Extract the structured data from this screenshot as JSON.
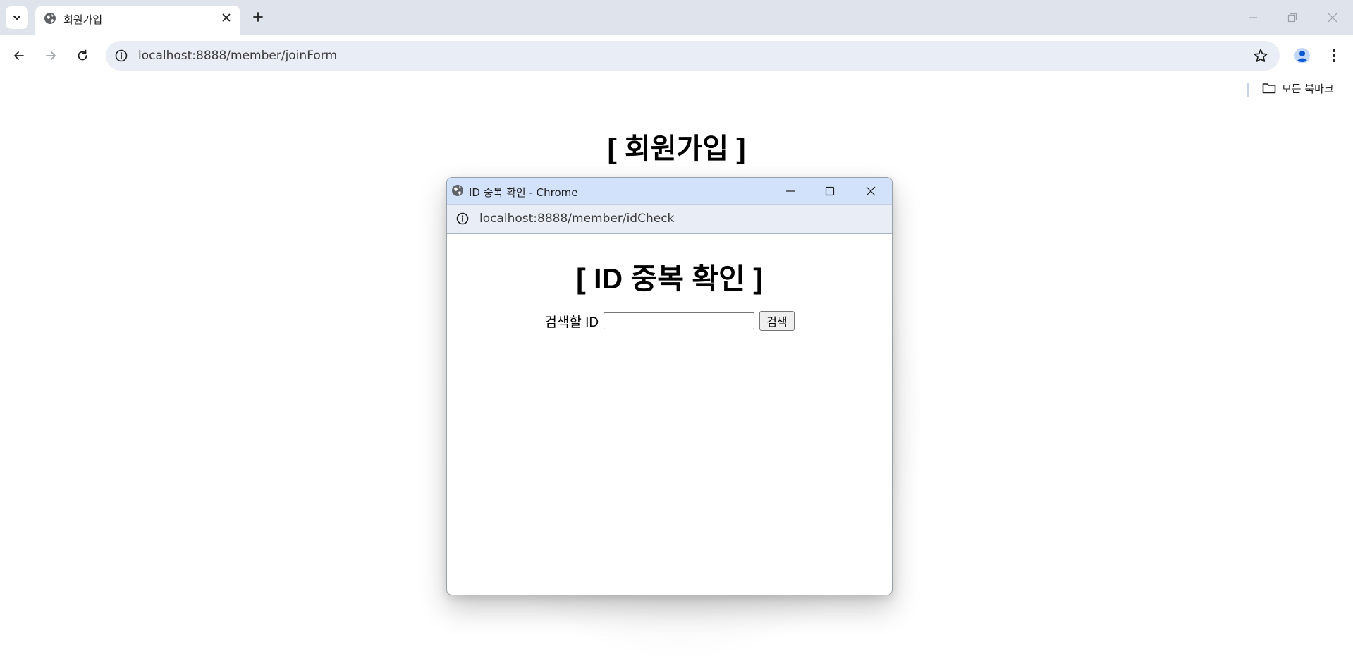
{
  "browser": {
    "tab": {
      "title": "회원가입"
    },
    "omnibox": {
      "url": "localhost:8888/member/joinForm"
    },
    "bookmarks": {
      "all_label": "모든 북마크"
    }
  },
  "page": {
    "title": "[ 회원가입 ]"
  },
  "popup": {
    "window_title": "ID 중복 확인 - Chrome",
    "url": "localhost:8888/member/idCheck",
    "heading": "[ ID 중복 확인 ]",
    "search": {
      "label": "검색할 ID",
      "input_value": "",
      "button_label": "검색"
    }
  },
  "icons": {
    "tab_favicon": "globe-icon",
    "popup_favicon": "globe-icon",
    "info": "info-icon",
    "star": "star-icon",
    "profile": "person-icon",
    "menu": "kebab-menu-icon",
    "folder": "folder-icon"
  },
  "colors": {
    "tabstrip_bg": "#dfe3eb",
    "omnibox_bg": "#e9edf6",
    "popup_titlebar_bg": "#d3e2fb",
    "profile_accent": "#0b57d0"
  }
}
